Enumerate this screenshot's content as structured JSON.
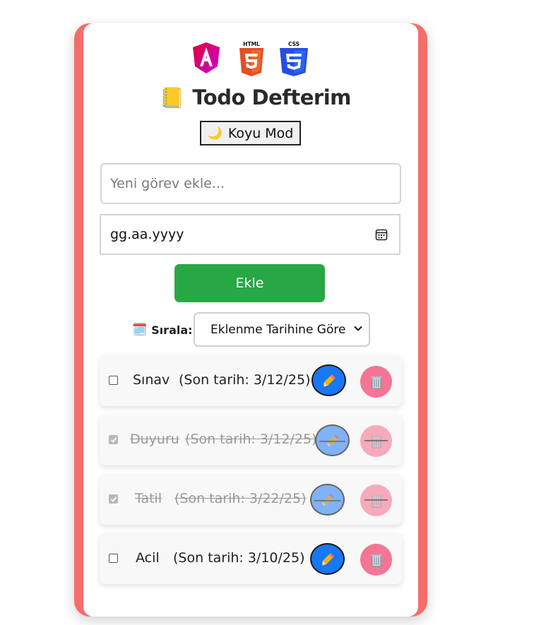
{
  "header": {
    "logos": [
      {
        "name": "angular-logo",
        "color": "#dd0031"
      },
      {
        "name": "html5-logo",
        "label": "HTML",
        "color": "#e44d26"
      },
      {
        "name": "css3-logo",
        "label": "CSS",
        "color": "#264de4"
      }
    ],
    "book_icon": "📒",
    "title": "Todo Defterim",
    "mode_button": {
      "icon": "🌙",
      "label": "Koyu Mod"
    }
  },
  "form": {
    "task_placeholder": "Yeni görev ekle...",
    "date_value": "gg.aa.yyyy",
    "add_label": "Ekle"
  },
  "sort": {
    "icon": "🗓️",
    "label": "Sırala:",
    "selected": "Eklenme Tarihine Göre"
  },
  "todos": [
    {
      "title": "Sınav",
      "due": "(Son tarih: 3/12/25)",
      "completed": false
    },
    {
      "title": "Duyuru",
      "due": "(Son tarih: 3/12/25)",
      "completed": true
    },
    {
      "title": "Tatil",
      "due": "(Son tarih: 3/22/25)",
      "completed": true
    },
    {
      "title": "Acil",
      "due": "(Son tarih: 3/10/25)",
      "completed": false
    }
  ],
  "colors": {
    "frame": "#f56d6b",
    "add": "#28a745",
    "edit": "#1877f2",
    "delete": "#f47596"
  }
}
